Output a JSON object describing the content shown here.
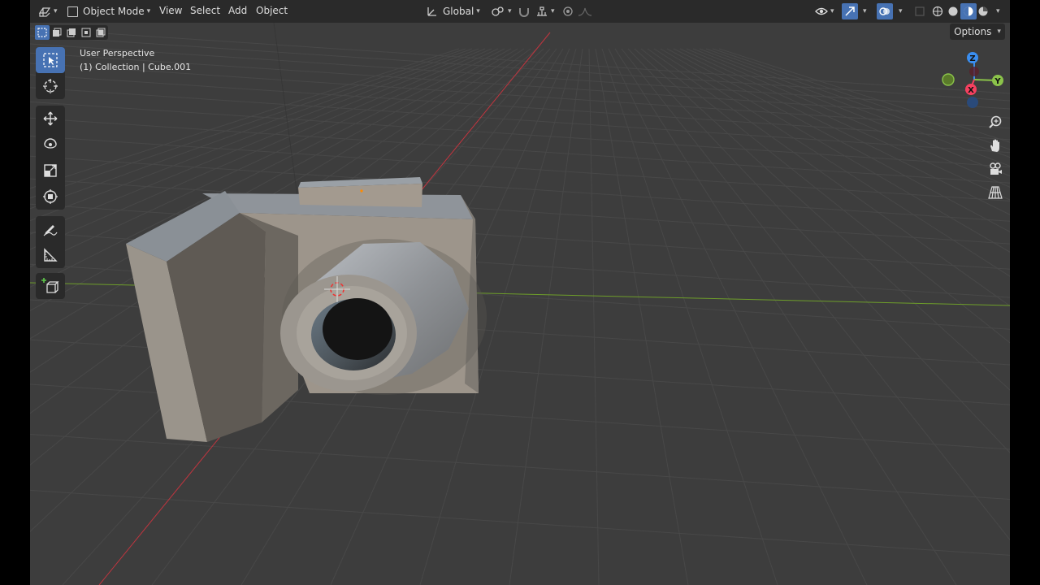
{
  "header": {
    "mode_label": "Object Mode",
    "menus": [
      "View",
      "Select",
      "Add",
      "Object"
    ],
    "orientation_label": "Global"
  },
  "toolbar": {
    "tools": [
      "select-box",
      "cursor",
      "move",
      "rotate",
      "scale",
      "transform",
      "annotate",
      "measure",
      "add-cube"
    ],
    "active_tool": "select-box"
  },
  "viewport_info": {
    "perspective": "User Perspective",
    "collection": "(1) Collection | Cube.001"
  },
  "options_label": "Options",
  "gizmo": {
    "z": "Z",
    "y": "Y",
    "x": "X",
    "colors": {
      "x": "#f5405f",
      "y": "#8bc34a",
      "z": "#3a8ef0"
    }
  },
  "colors": {
    "viewport_bg": "#3d3d3d",
    "header_bg": "#2a2a2a",
    "accent": "#4772b3",
    "x_axis": "#c1353f",
    "y_axis": "#6e9e2a"
  }
}
